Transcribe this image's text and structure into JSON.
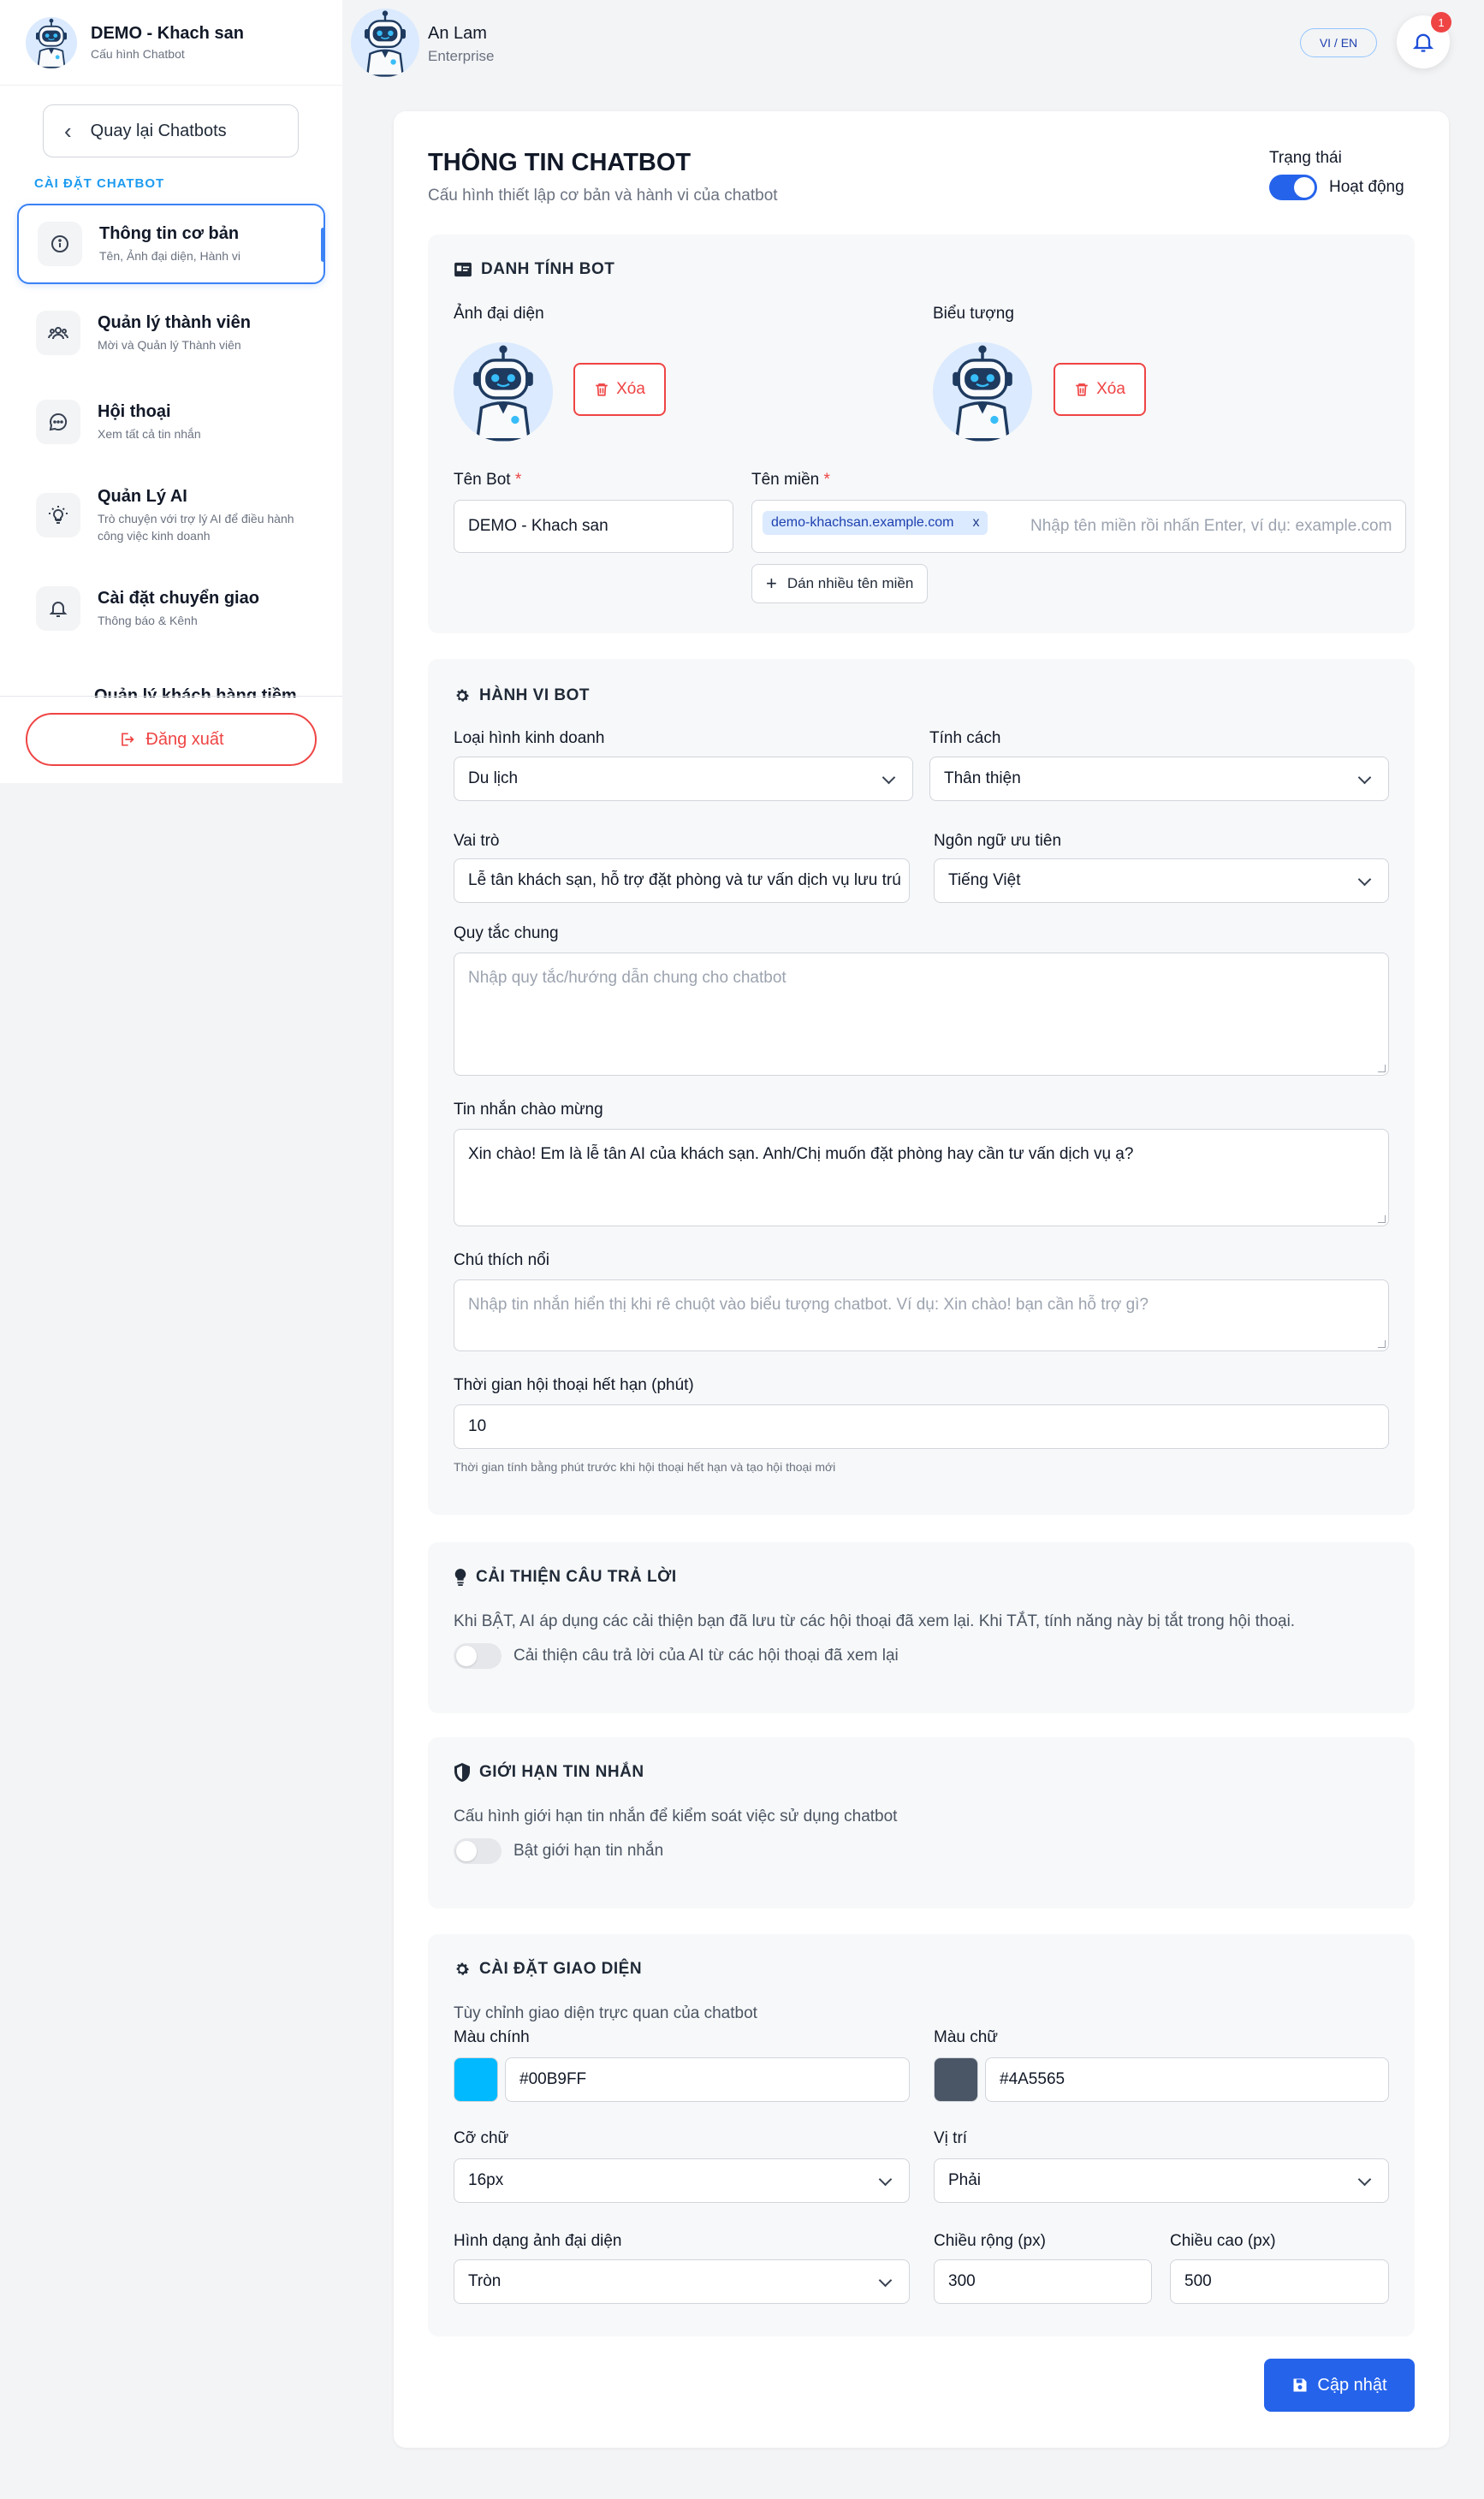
{
  "sidebar": {
    "bot_name": "DEMO - Khach san",
    "bot_subtitle": "Cấu hình Chatbot",
    "back_label": "Quay lại Chatbots",
    "section_label": "CÀI ĐẶT CHATBOT",
    "items": [
      {
        "title": "Thông tin cơ bản",
        "subtitle": "Tên, Ảnh đại diện, Hành vi",
        "icon": "info-icon"
      },
      {
        "title": "Quản lý thành viên",
        "subtitle": "Mời và Quản lý Thành viên",
        "icon": "users-icon"
      },
      {
        "title": "Hội thoại",
        "subtitle": "Xem tất cả tin nhắn",
        "icon": "chat-icon"
      },
      {
        "title": "Quản Lý AI",
        "subtitle": "Trò chuyện với trợ lý AI để điều hành công việc kinh doanh",
        "icon": "lightbulb-icon"
      },
      {
        "title": "Cài đặt chuyển giao",
        "subtitle": "Thông báo & Kênh",
        "icon": "bell-icon"
      },
      {
        "title": "Quản lý khách hàng tiềm",
        "subtitle": "",
        "icon": ""
      }
    ],
    "logout_label": "Đăng xuất"
  },
  "topbar": {
    "user_name": "An Lam",
    "user_role": "Enterprise",
    "lang_label": "VI / EN",
    "notification_count": "1"
  },
  "page": {
    "title": "THÔNG TIN CHATBOT",
    "subtitle": "Cấu hình thiết lập cơ bản và hành vi của chatbot",
    "status_label": "Trạng thái",
    "status_value": "Hoạt động",
    "status_on": true
  },
  "identity": {
    "heading": "DANH TÍNH BOT",
    "avatar_label": "Ảnh đại diện",
    "icon_label": "Biểu tượng",
    "delete_label": "Xóa",
    "bot_name_label": "Tên Bot",
    "bot_name_value": "DEMO - Khach san",
    "domain_label": "Tên miền",
    "domain_tag": "demo-khachsan.example.com",
    "domain_tag_remove": "x",
    "domain_placeholder": "Nhập tên miền rồi nhấn Enter, ví dụ: example.com",
    "multi_domain_label": "Dán nhiều tên miền",
    "required_mark": "*"
  },
  "behavior": {
    "heading": "HÀNH VI BOT",
    "business_label": "Loại hình kinh doanh",
    "business_value": "Du lịch",
    "personality_label": "Tính cách",
    "personality_value": "Thân thiện",
    "role_label": "Vai trò",
    "role_value": "Lễ tân khách sạn, hỗ trợ đặt phòng và tư vấn dịch vụ lưu trú",
    "language_label": "Ngôn ngữ ưu tiên",
    "language_value": "Tiếng Việt",
    "rules_label": "Quy tắc chung",
    "rules_placeholder": "Nhập quy tắc/hướng dẫn chung cho chatbot",
    "welcome_label": "Tin nhắn chào mừng",
    "welcome_value": "Xin chào! Em là lễ tân AI của khách sạn. Anh/Chị muốn đặt phòng hay cần tư vấn dịch vụ ạ?",
    "tooltip_label": "Chú thích nổi",
    "tooltip_placeholder": "Nhập tin nhắn hiển thị khi rê chuột vào biểu tượng chatbot. Ví dụ: Xin chào! bạn cần hỗ trợ gì?",
    "timeout_label": "Thời gian hội thoại hết hạn (phút)",
    "timeout_value": "10",
    "timeout_hint": "Thời gian tính bằng phút trước khi hội thoại hết hạn và tạo hội thoại mới"
  },
  "improve": {
    "heading": "CẢI THIỆN CÂU TRẢ LỜI",
    "description": "Khi BẬT, AI áp dụng các cải thiện bạn đã lưu từ các hội thoại đã xem lại. Khi TẮT, tính năng này bị tắt trong hội thoại.",
    "toggle_label": "Cải thiện câu trả lời của AI từ các hội thoại đã xem lại",
    "enabled": false
  },
  "limit": {
    "heading": "GIỚI HẠN TIN NHẮN",
    "description": "Cấu hình giới hạn tin nhắn để kiểm soát việc sử dụng chatbot",
    "toggle_label": "Bật giới hạn tin nhắn",
    "enabled": false
  },
  "appearance": {
    "heading": "CÀI ĐẶT GIAO DIỆN",
    "description": "Tùy chỉnh giao diện trực quan của chatbot",
    "primary_label": "Màu chính",
    "primary_value": "#00B9FF",
    "text_color_label": "Màu chữ",
    "text_color_value": "#4A5565",
    "font_size_label": "Cỡ chữ",
    "font_size_value": "16px",
    "position_label": "Vị trí",
    "position_value": "Phải",
    "avatar_shape_label": "Hình dạng ảnh đại diện",
    "avatar_shape_value": "Tròn",
    "width_label": "Chiều rộng (px)",
    "width_value": "300",
    "height_label": "Chiều cao (px)",
    "height_value": "500"
  },
  "save_label": "Cập nhật",
  "colors": {
    "accent": "#2563eb",
    "danger": "#ef4444",
    "section_blue": "#1d9bf0"
  }
}
